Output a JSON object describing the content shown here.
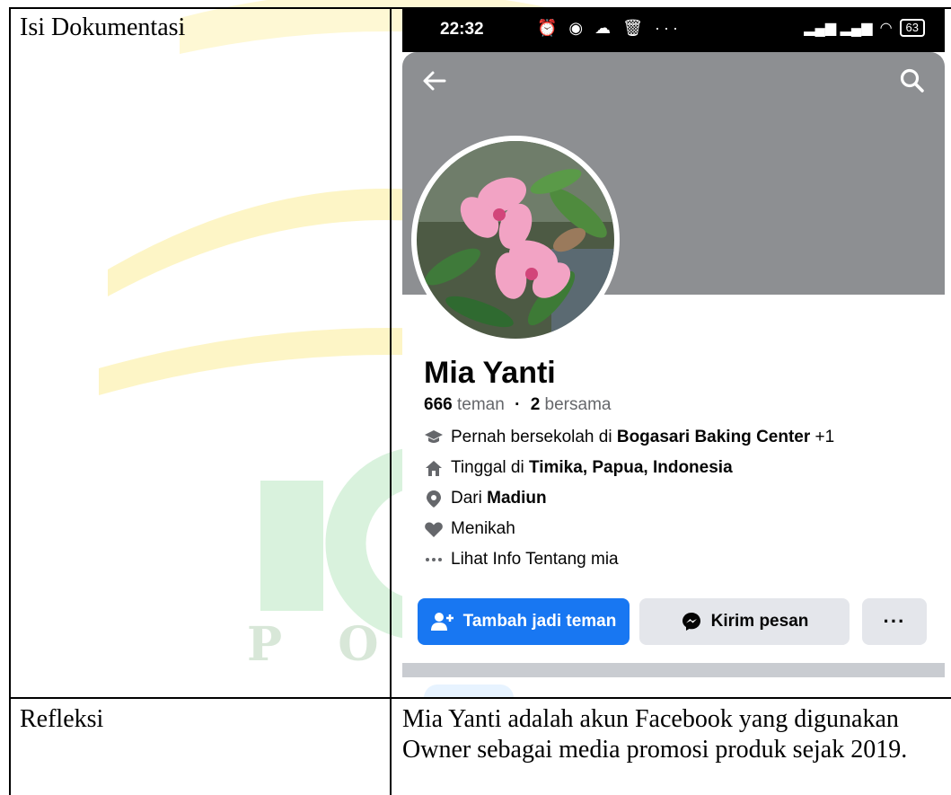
{
  "table": {
    "row1_label": "Isi Dokumentasi",
    "row2_label": "Refleksi",
    "reflection_text": "Mia Yanti adalah akun Facebook yang digunakan Owner sebagai media promosi produk sejak 2019."
  },
  "watermark": {
    "letters": "P O N"
  },
  "phone": {
    "status": {
      "time": "22:32",
      "icons": "⏰ ◉ ☁ 🗑 ···",
      "battery": "63"
    },
    "profile": {
      "name": "Mia Yanti",
      "friends_count": "666",
      "friends_label": "teman",
      "separator": "·",
      "mutual_count": "2",
      "mutual_label": "bersama",
      "info": [
        {
          "icon": "graduation-cap-icon",
          "prefix": "Pernah bersekolah di",
          "bold": "Bogasari Baking Center",
          "suffix": "+1"
        },
        {
          "icon": "home-icon",
          "prefix": "Tinggal di",
          "bold": "Timika, Papua, Indonesia",
          "suffix": ""
        },
        {
          "icon": "location-pin-icon",
          "prefix": "Dari",
          "bold": "Madiun",
          "suffix": ""
        },
        {
          "icon": "heart-icon",
          "prefix": "Menikah",
          "bold": "",
          "suffix": ""
        },
        {
          "icon": "more-dots-icon",
          "prefix": "Lihat Info Tentang mia",
          "bold": "",
          "suffix": ""
        }
      ]
    },
    "buttons": {
      "add_friend": "Tambah jadi teman",
      "message": "Kirim pesan",
      "more": "···"
    },
    "colors": {
      "primary": "#1877f2",
      "secondary_button": "#e4e6eb",
      "cover": "#8d8f92"
    }
  }
}
